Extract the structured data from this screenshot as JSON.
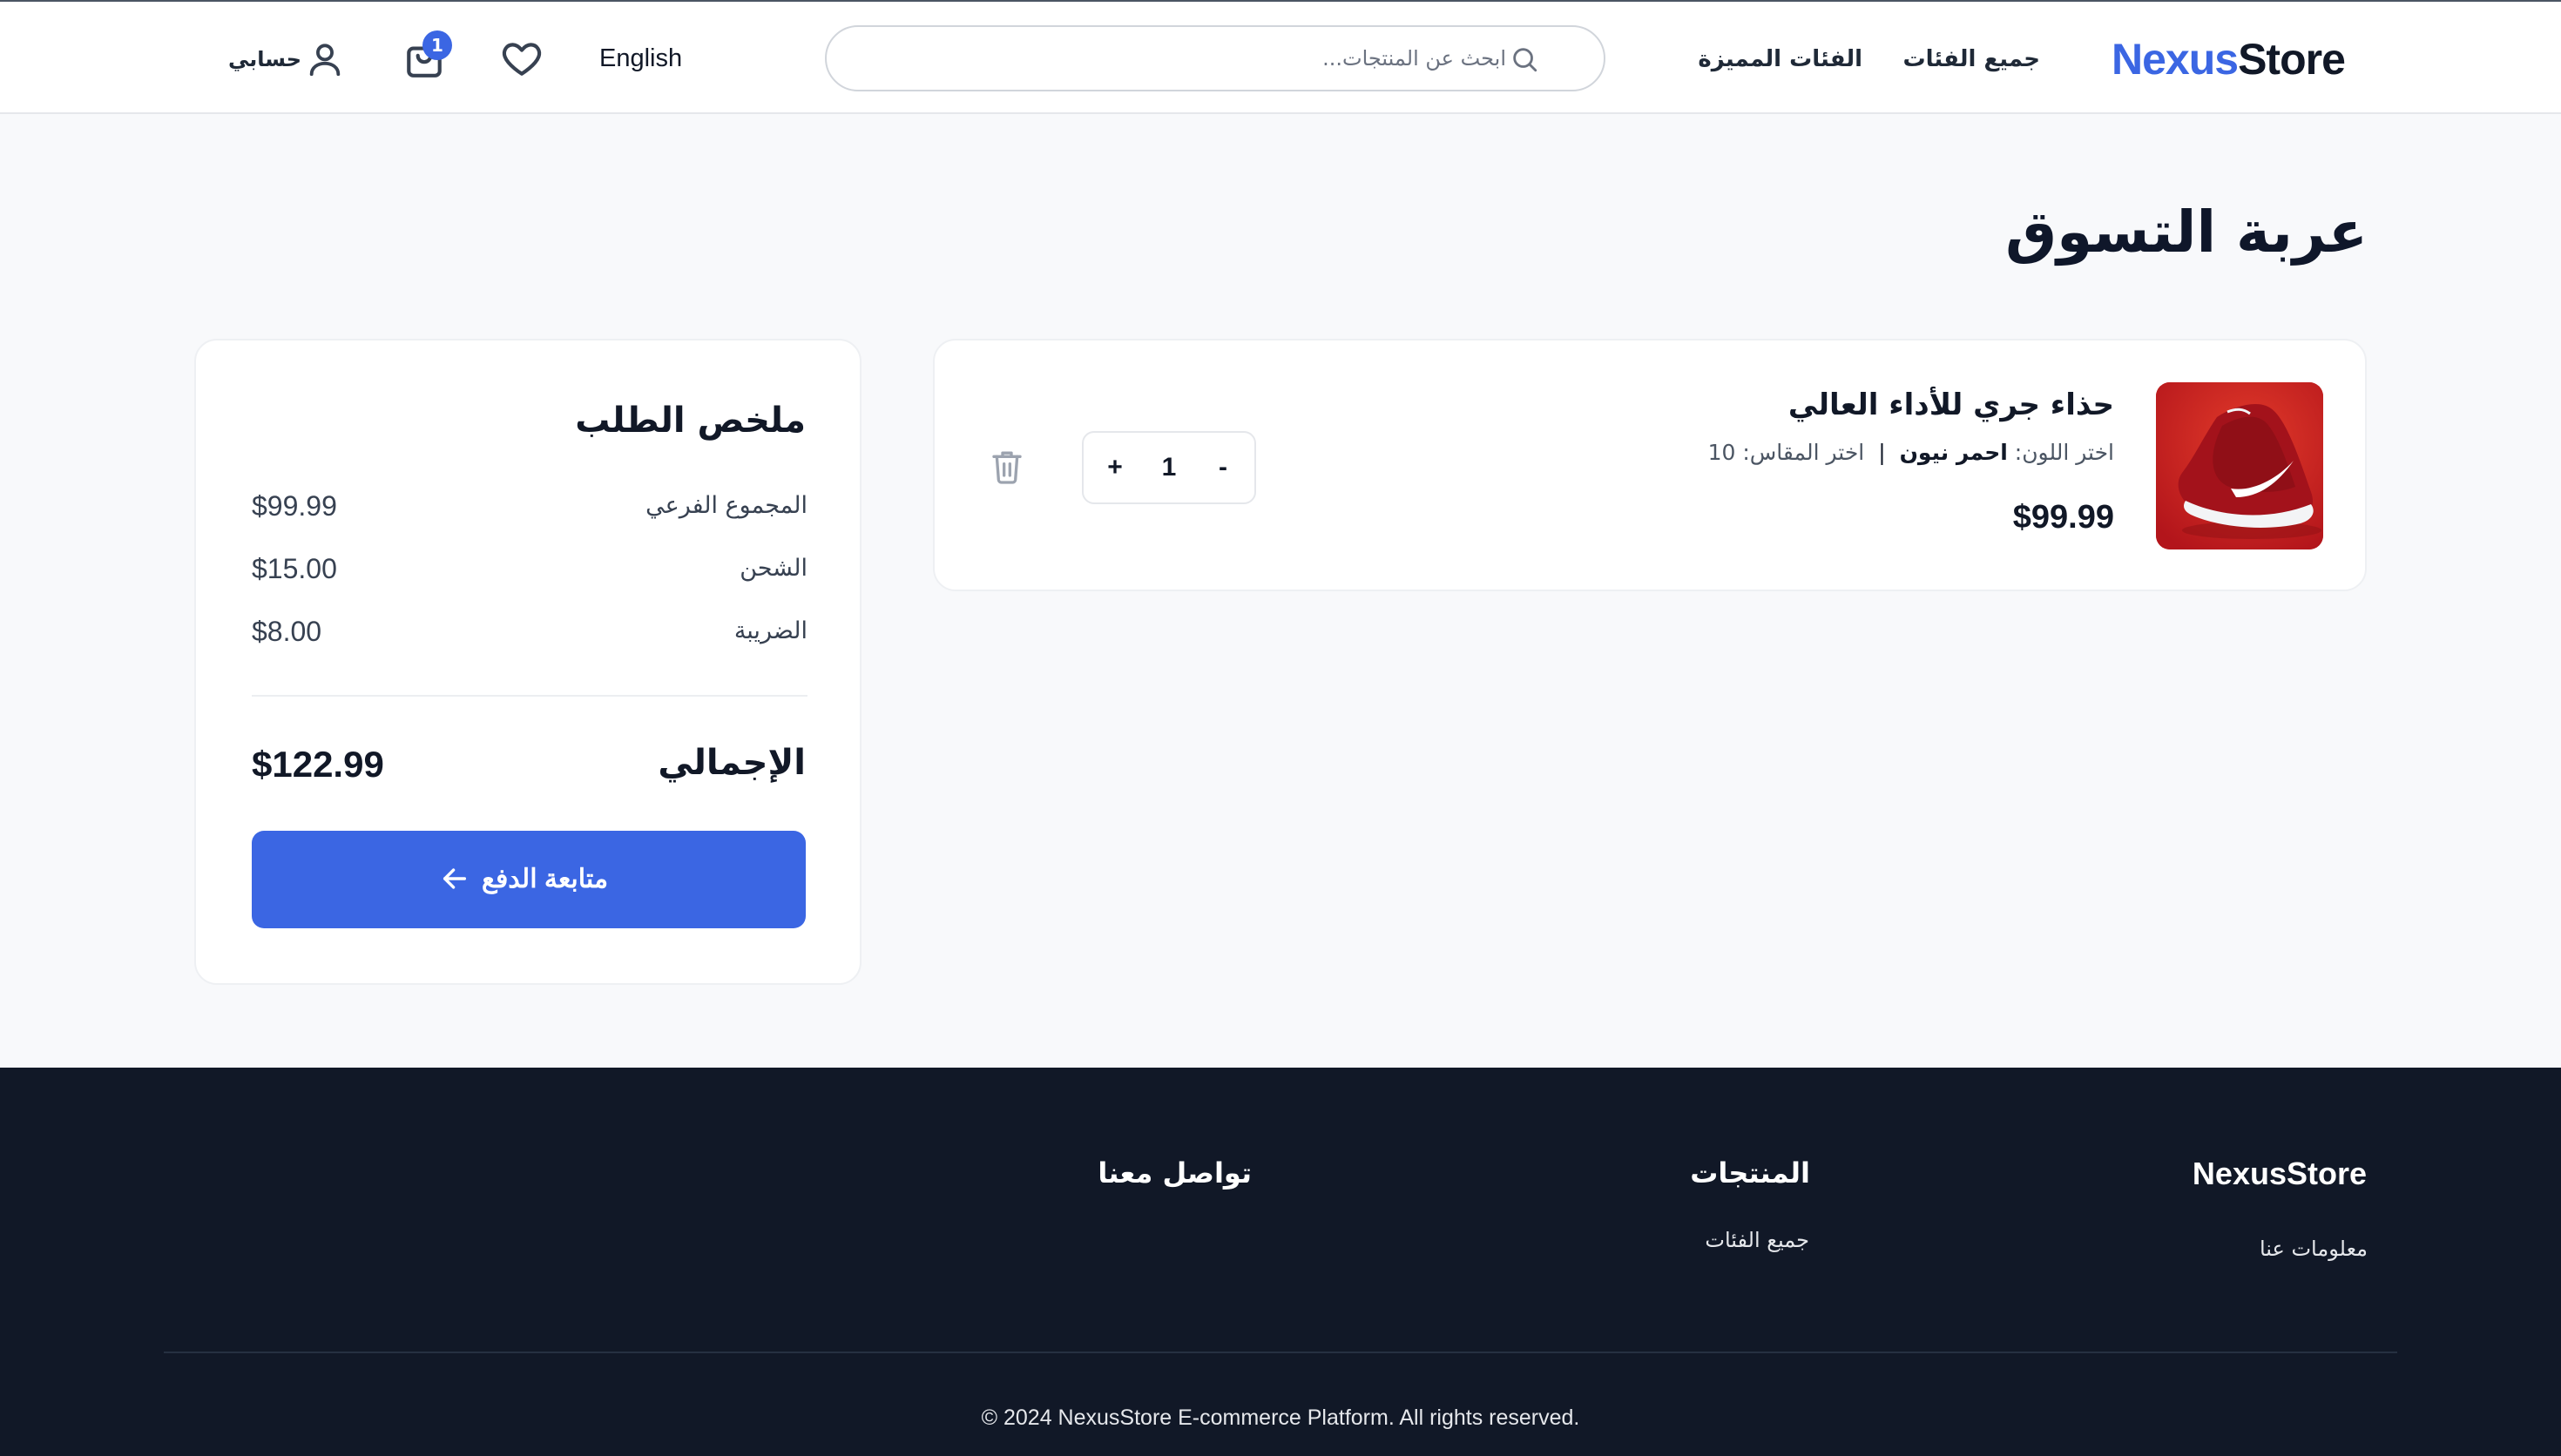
{
  "header": {
    "logo": {
      "part1": "Nexus",
      "part2": "Store"
    },
    "nav": {
      "all_categories": "جميع الفئات",
      "featured_categories": "الفئات المميزة"
    },
    "search": {
      "placeholder": "ابحث عن المنتجات...",
      "value": ""
    },
    "language": "English",
    "cart_count": "1",
    "account": "حسابي"
  },
  "main": {
    "title": "عربة التسوق",
    "cart_items": [
      {
        "name": "حذاء جري للأداء العالي",
        "color_label": "اختر اللون:",
        "color_value": "احمر نيون",
        "separator": "|",
        "size_label": "اختر المقاس:",
        "size_value": "10",
        "price": "$99.99",
        "quantity": "1",
        "qty_plus": "+",
        "qty_minus": "-"
      }
    ],
    "summary": {
      "title": "ملخص الطلب",
      "subtotal_label": "المجموع الفرعي",
      "subtotal": "$99.99",
      "shipping_label": "الشحن",
      "shipping": "$15.00",
      "tax_label": "الضريبة",
      "tax": "$8.00",
      "total_label": "الإجمالي",
      "total": "$122.99",
      "checkout": "متابعة الدفع"
    }
  },
  "footer": {
    "brand": "NexusStore",
    "about": "معلومات عنا",
    "products_heading": "المنتجات",
    "products_link": "جميع الفئات",
    "contact_heading": "تواصل معنا",
    "copyright": "© 2024 NexusStore E-commerce Platform. All rights reserved."
  },
  "colors": {
    "accent": "#3b66e3",
    "footer_bg": "#111827",
    "page_bg": "#f8f9fb",
    "product_red": "#c81e1e"
  },
  "icons": [
    "search-icon",
    "heart-icon",
    "cart-icon",
    "user-icon",
    "trash-icon",
    "arrow-left-icon"
  ]
}
